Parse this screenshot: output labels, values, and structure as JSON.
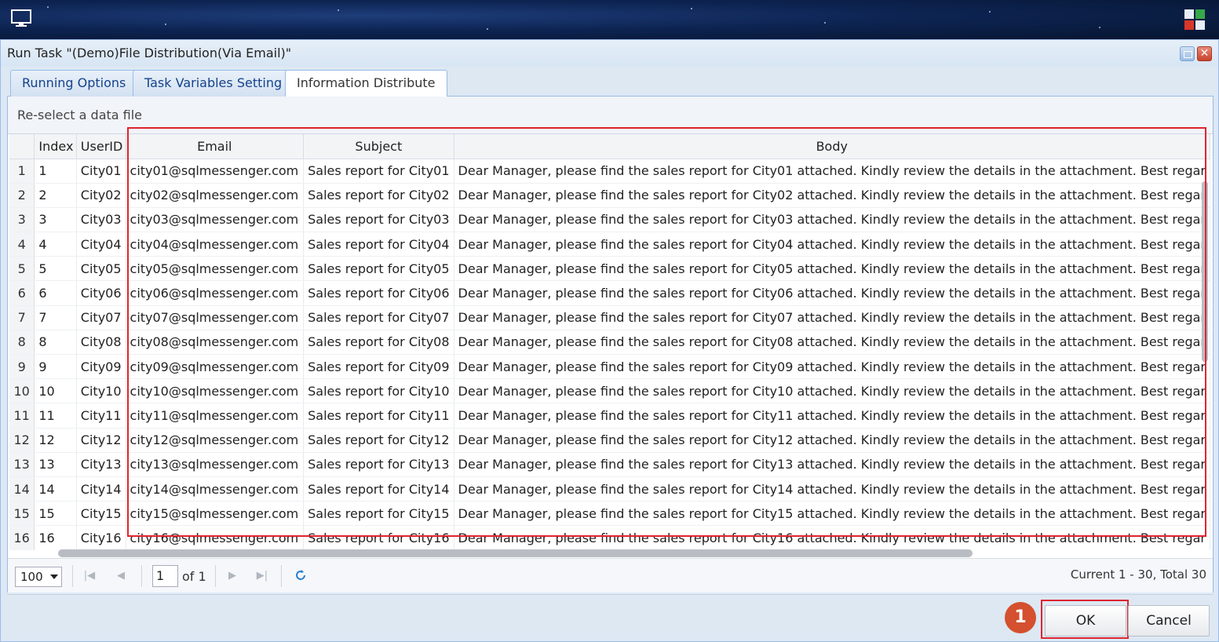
{
  "window": {
    "title": "Run Task \"(Demo)File Distribution(Via Email)\""
  },
  "tabs": [
    {
      "label": "Running Options"
    },
    {
      "label": "Task Variables Setting"
    },
    {
      "label": "Information Distribute"
    }
  ],
  "toolbar": {
    "reselect_label": "Re-select a data file"
  },
  "table": {
    "columns": [
      "Index",
      "UserID",
      "Email",
      "Subject",
      "Body"
    ],
    "rows": [
      {
        "n": "1",
        "index": "1",
        "userid": "City01",
        "email": "city01@sqlmessenger.com",
        "subject": "Sales report for City01",
        "body": "Dear Manager, please find the sales report for City01 attached. Kindly review the details in the attachment. Best regar"
      },
      {
        "n": "2",
        "index": "2",
        "userid": "City02",
        "email": "city02@sqlmessenger.com",
        "subject": "Sales report for City02",
        "body": "Dear Manager, please find the sales report for City02 attached. Kindly review the details in the attachment. Best regar"
      },
      {
        "n": "3",
        "index": "3",
        "userid": "City03",
        "email": "city03@sqlmessenger.com",
        "subject": "Sales report for City03",
        "body": "Dear Manager, please find the sales report for City03 attached. Kindly review the details in the attachment. Best regar"
      },
      {
        "n": "4",
        "index": "4",
        "userid": "City04",
        "email": "city04@sqlmessenger.com",
        "subject": "Sales report for City04",
        "body": "Dear Manager, please find the sales report for City04 attached. Kindly review the details in the attachment. Best regar"
      },
      {
        "n": "5",
        "index": "5",
        "userid": "City05",
        "email": "city05@sqlmessenger.com",
        "subject": "Sales report for City05",
        "body": "Dear Manager, please find the sales report for City05 attached. Kindly review the details in the attachment. Best regar"
      },
      {
        "n": "6",
        "index": "6",
        "userid": "City06",
        "email": "city06@sqlmessenger.com",
        "subject": "Sales report for City06",
        "body": "Dear Manager, please find the sales report for City06 attached. Kindly review the details in the attachment. Best regar"
      },
      {
        "n": "7",
        "index": "7",
        "userid": "City07",
        "email": "city07@sqlmessenger.com",
        "subject": "Sales report for City07",
        "body": "Dear Manager, please find the sales report for City07 attached. Kindly review the details in the attachment. Best regar"
      },
      {
        "n": "8",
        "index": "8",
        "userid": "City08",
        "email": "city08@sqlmessenger.com",
        "subject": "Sales report for City08",
        "body": "Dear Manager, please find the sales report for City08 attached. Kindly review the details in the attachment. Best regar"
      },
      {
        "n": "9",
        "index": "9",
        "userid": "City09",
        "email": "city09@sqlmessenger.com",
        "subject": "Sales report for City09",
        "body": "Dear Manager, please find the sales report for City09 attached. Kindly review the details in the attachment. Best regar"
      },
      {
        "n": "10",
        "index": "10",
        "userid": "City10",
        "email": "city10@sqlmessenger.com",
        "subject": "Sales report for City10",
        "body": "Dear Manager, please find the sales report for City10 attached. Kindly review the details in the attachment. Best regar"
      },
      {
        "n": "11",
        "index": "11",
        "userid": "City11",
        "email": "city11@sqlmessenger.com",
        "subject": "Sales report for City11",
        "body": "Dear Manager, please find the sales report for City11 attached. Kindly review the details in the attachment. Best regar"
      },
      {
        "n": "12",
        "index": "12",
        "userid": "City12",
        "email": "city12@sqlmessenger.com",
        "subject": "Sales report for City12",
        "body": "Dear Manager, please find the sales report for City12 attached. Kindly review the details in the attachment. Best regar"
      },
      {
        "n": "13",
        "index": "13",
        "userid": "City13",
        "email": "city13@sqlmessenger.com",
        "subject": "Sales report for City13",
        "body": "Dear Manager, please find the sales report for City13 attached. Kindly review the details in the attachment. Best regar"
      },
      {
        "n": "14",
        "index": "14",
        "userid": "City14",
        "email": "city14@sqlmessenger.com",
        "subject": "Sales report for City14",
        "body": "Dear Manager, please find the sales report for City14 attached. Kindly review the details in the attachment. Best regar"
      },
      {
        "n": "15",
        "index": "15",
        "userid": "City15",
        "email": "city15@sqlmessenger.com",
        "subject": "Sales report for City15",
        "body": "Dear Manager, please find the sales report for City15 attached. Kindly review the details in the attachment. Best regar"
      },
      {
        "n": "16",
        "index": "16",
        "userid": "City16",
        "email": "city16@sqlmessenger.com",
        "subject": "Sales report for City16",
        "body": "Dear Manager, please find the sales report for City16 attached. Kindly review the details in the attachment. Best regar"
      }
    ]
  },
  "pager": {
    "page_size": "100",
    "current_page": "1",
    "of_label": "of 1",
    "info": "Current 1 - 30, Total 30"
  },
  "buttons": {
    "ok": "OK",
    "cancel": "Cancel"
  },
  "annotations": {
    "step_badge": "1"
  },
  "icons": {
    "desktop": "monitor-icon",
    "app": "app-logo-icon",
    "restore": "restore-icon",
    "close": "close-icon",
    "first": "first-page-icon",
    "prev": "prev-page-icon",
    "next": "next-page-icon",
    "last": "last-page-icon",
    "refresh": "refresh-icon"
  },
  "colors": {
    "highlight": "#e0242f",
    "badge": "#d4502f"
  }
}
